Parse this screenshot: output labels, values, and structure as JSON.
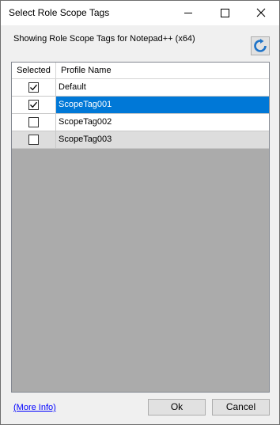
{
  "window": {
    "title": "Select Role Scope Tags"
  },
  "subtitle": "Showing Role Scope Tags for Notepad++ (x64)",
  "grid": {
    "columns": [
      "Selected",
      "Profile Name"
    ],
    "rows": [
      {
        "selected": true,
        "name": "Default"
      },
      {
        "selected": true,
        "name": "ScopeTag001"
      },
      {
        "selected": false,
        "name": "ScopeTag002"
      },
      {
        "selected": false,
        "name": "ScopeTag003"
      }
    ]
  },
  "footer": {
    "more_info": "(More Info)",
    "ok_label": "Ok",
    "cancel_label": "Cancel"
  },
  "colors": {
    "selection": "#0078d7",
    "grid_background": "#ababab",
    "link": "#0000ff"
  },
  "icons": {
    "refresh": "refresh-icon"
  }
}
